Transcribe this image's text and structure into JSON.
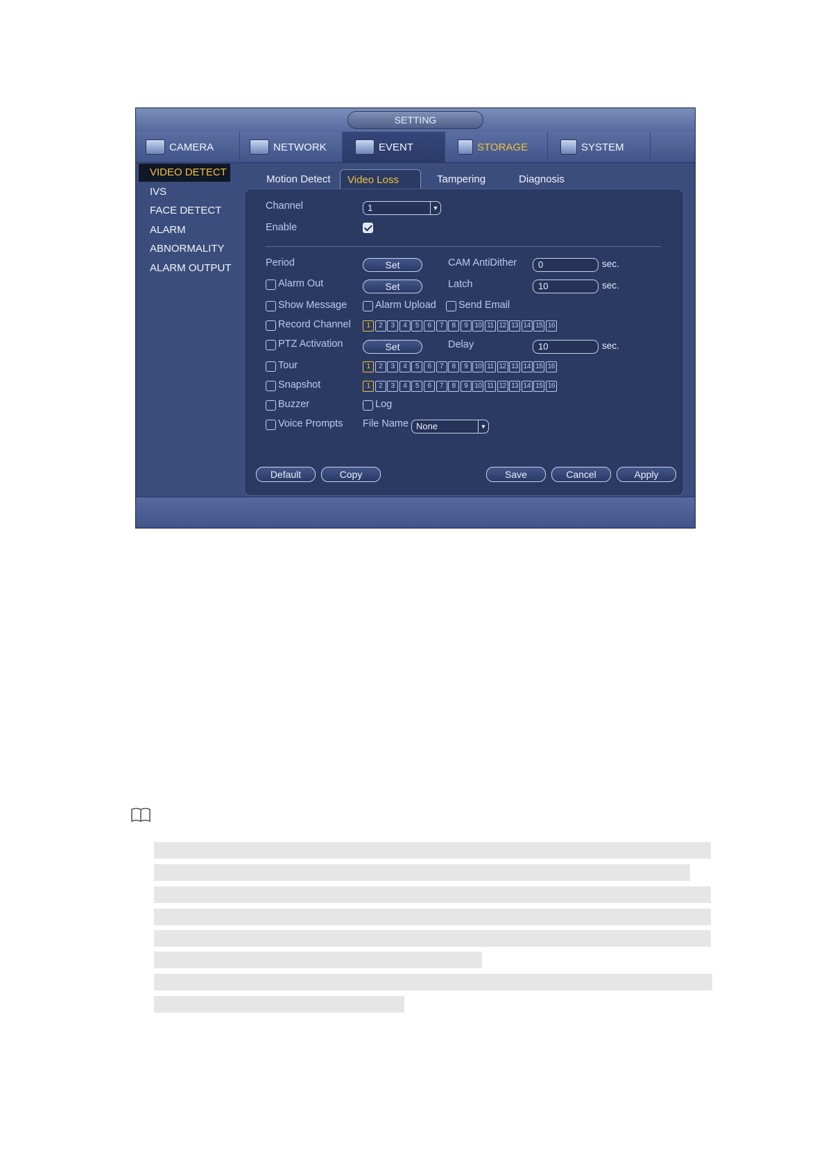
{
  "window": {
    "title": "SETTING"
  },
  "topnav": [
    {
      "label": "CAMERA",
      "icon": "camera-icon"
    },
    {
      "label": "NETWORK",
      "icon": "network-icon"
    },
    {
      "label": "EVENT",
      "icon": "event-icon",
      "active": true
    },
    {
      "label": "STORAGE",
      "icon": "storage-icon"
    },
    {
      "label": "SYSTEM",
      "icon": "system-icon"
    }
  ],
  "sidebar": [
    {
      "label": "VIDEO DETECT",
      "active": true
    },
    {
      "label": "IVS"
    },
    {
      "label": "FACE DETECT"
    },
    {
      "label": "ALARM"
    },
    {
      "label": "ABNORMALITY"
    },
    {
      "label": "ALARM OUTPUT"
    }
  ],
  "subtabs": [
    {
      "label": "Motion Detect"
    },
    {
      "label": "Video Loss",
      "active": true
    },
    {
      "label": "Tampering"
    },
    {
      "label": "Diagnosis"
    }
  ],
  "form": {
    "channel_label": "Channel",
    "channel_value": "1",
    "enable_label": "Enable",
    "enable_checked": true,
    "period_label": "Period",
    "set_label": "Set",
    "cam_antidither_label": "CAM AntiDither",
    "cam_antidither_value": "0",
    "sec_label": "sec.",
    "alarm_out_label": "Alarm Out",
    "latch_label": "Latch",
    "latch_value": "10",
    "show_message_label": "Show Message",
    "alarm_upload_label": "Alarm Upload",
    "send_email_label": "Send Email",
    "record_channel_label": "Record Channel",
    "ptz_activation_label": "PTZ Activation",
    "delay_label": "Delay",
    "delay_value": "10",
    "tour_label": "Tour",
    "snapshot_label": "Snapshot",
    "buzzer_label": "Buzzer",
    "log_label": "Log",
    "voice_prompts_label": "Voice Prompts",
    "file_name_label": "File Name",
    "file_name_value": "None",
    "channels": [
      "1",
      "2",
      "3",
      "4",
      "5",
      "6",
      "7",
      "8",
      "9",
      "10",
      "11",
      "12",
      "13",
      "14",
      "15",
      "16"
    ]
  },
  "buttons": {
    "default": "Default",
    "copy": "Copy",
    "save": "Save",
    "cancel": "Cancel",
    "apply": "Apply"
  },
  "colors": {
    "accent": "#f2c23a",
    "panel": "#2b3a63",
    "label": "#b9cbf2"
  }
}
